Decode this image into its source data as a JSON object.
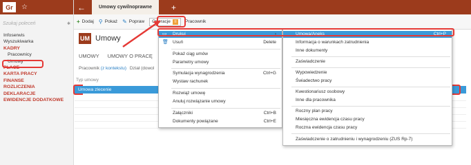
{
  "sidebar": {
    "logo": "Gr",
    "star": "☆",
    "search_placeholder": "Szukaj poleceń",
    "pin": "📌",
    "items": [
      {
        "label": "Infoserwis"
      },
      {
        "label": "Wyszukiwarka"
      },
      {
        "label": "KADRY"
      },
      {
        "label": "Pracownicy"
      },
      {
        "label": "Umowy"
      },
      {
        "label": "PŁACE"
      },
      {
        "label": "KARTA PRACY"
      },
      {
        "label": "FINANSE"
      },
      {
        "label": "ROZLICZENIA"
      },
      {
        "label": "DEKLARACJE"
      },
      {
        "label": "EWIDENCJE DODATKOWE"
      }
    ]
  },
  "header": {
    "back": "←",
    "tab_title": "Umowy cywilnoprawne",
    "plus": "+"
  },
  "toolbar": {
    "add": "Dodaj",
    "show": "Pokaż",
    "edit": "Popraw",
    "ops": "Operacje",
    "employee": "Pracownik"
  },
  "main": {
    "page_icon": "UM",
    "page_title": "Umowy",
    "tabs": [
      "UMOWY",
      "UMOWY O PRACĘ"
    ],
    "filter_prefix": "Pracownik",
    "filter_link": "(z kontekstu)",
    "filter_rest": "Dział (dowol",
    "col_header": "Typ umowy",
    "selected_row": "Umowa zlecenie"
  },
  "menu1": [
    {
      "label": "Drukuj",
      "shortcut": "",
      "icon": "printer-icon",
      "submenu": true
    },
    {
      "label": "Usuń",
      "shortcut": "Delete",
      "icon": "trash-icon"
    },
    {
      "label": "Pokaż ciąg umów",
      "shortcut": ""
    },
    {
      "label": "Parametry umowy",
      "shortcut": ""
    },
    {
      "label": "Symulacja wynagrodzenia",
      "shortcut": "Ctrl+G"
    },
    {
      "label": "Wystaw rachunek",
      "shortcut": ""
    },
    {
      "label": "Rozwiąż umowę",
      "shortcut": ""
    },
    {
      "label": "Anuluj rozwiązanie umowy",
      "shortcut": ""
    },
    {
      "label": "Załączniki",
      "shortcut": "Ctrl+B"
    },
    {
      "label": "Dokumenty powiązane",
      "shortcut": "Ctrl+E"
    }
  ],
  "menu2": [
    {
      "label": "Umowa/Aneks",
      "shortcut": "Ctrl+P"
    },
    {
      "label": "Informacja o warunkach zatrudnienia",
      "shortcut": ""
    },
    {
      "label": "Inne dokumenty",
      "shortcut": ""
    },
    {
      "label": "Zaświadczenie",
      "shortcut": ""
    },
    {
      "label": "Wypowiedzenie",
      "shortcut": ""
    },
    {
      "label": "Świadectwo pracy",
      "shortcut": ""
    },
    {
      "label": "Kwestionariusz osobowy",
      "shortcut": ""
    },
    {
      "label": "Inne dla pracownika",
      "shortcut": ""
    },
    {
      "label": "Roczny plan pracy",
      "shortcut": ""
    },
    {
      "label": "Miesięczna ewidencja czasu pracy",
      "shortcut": ""
    },
    {
      "label": "Roczna ewidencja czasu pracy",
      "shortcut": ""
    },
    {
      "label": "Zaświadczenie o zatrudnieniu i wynagrodzeniu (ZUS Rp-7)",
      "shortcut": ""
    }
  ],
  "colors": {
    "brand": "#9c3b1c",
    "highlight": "#3a9ad9",
    "callout": "#e53935"
  }
}
